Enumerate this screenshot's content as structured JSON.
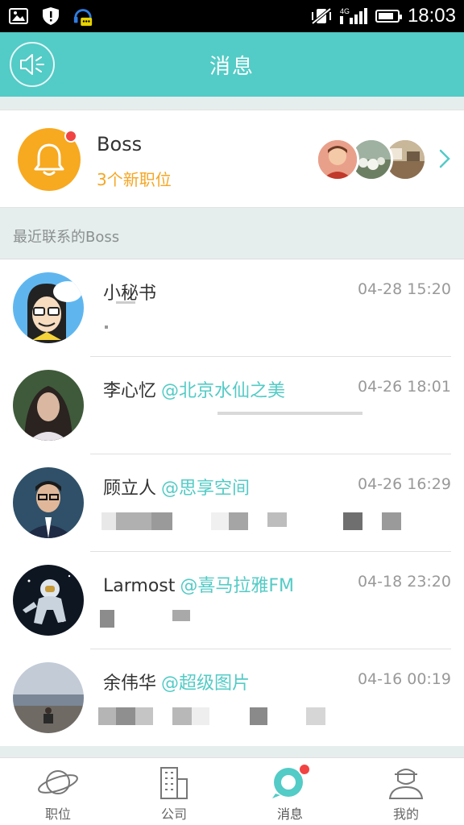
{
  "status_bar": {
    "time": "18:03",
    "network": "4G"
  },
  "header": {
    "title": "消息"
  },
  "boss_card": {
    "title": "Boss",
    "subtitle": "3个新职位"
  },
  "section": {
    "title": "最近联系的Boss"
  },
  "messages": [
    {
      "name": "小秘书",
      "company": "",
      "time": "04-28 15:20"
    },
    {
      "name": "李心忆",
      "company": "@北京水仙之美",
      "time": "04-26 18:01"
    },
    {
      "name": "顾立人",
      "company": "@思享空间",
      "time": "04-26 16:29"
    },
    {
      "name": "Larmost",
      "company": "@喜马拉雅FM",
      "time": "04-18 23:20"
    },
    {
      "name": "余伟华",
      "company": "@超级图片",
      "time": "04-16 00:19"
    }
  ],
  "tabs": [
    {
      "label": "职位",
      "icon": "planet-icon",
      "active": false
    },
    {
      "label": "公司",
      "icon": "building-icon",
      "active": false
    },
    {
      "label": "消息",
      "icon": "chat-bubble-icon",
      "active": true,
      "badge": true
    },
    {
      "label": "我的",
      "icon": "user-icon",
      "active": false
    }
  ],
  "colors": {
    "accent": "#53cbc6",
    "orange": "#f7a91f",
    "badge": "#f24343"
  }
}
